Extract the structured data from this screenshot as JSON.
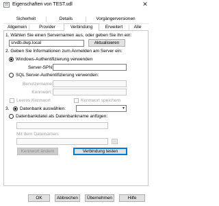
{
  "window": {
    "title": "Eigenschaften von TEST.udl",
    "close_glyph": "✕"
  },
  "tabs": {
    "row1": [
      {
        "label": "Sicherheit"
      },
      {
        "label": "Details"
      },
      {
        "label": "Vorgängerversionen"
      }
    ],
    "row2": [
      {
        "label": "Allgemein"
      },
      {
        "label": "Provider"
      },
      {
        "label": "Verbindung"
      },
      {
        "label": "Erweitert"
      },
      {
        "label": "Alle"
      }
    ],
    "selected": "Verbindung"
  },
  "step1": {
    "label": "1. Wählen Sie einen Servernamen aus, oder geben Sie ihn ein:",
    "server_value": "srvdb.dwp.local",
    "refresh_button": "Aktualisieren"
  },
  "step2": {
    "label": "2. Geben Sie Informationen zum Anmelden am Server ein:",
    "windows_auth": {
      "label": "Windows-Authentifizierung verwenden",
      "checked": true
    },
    "spn_label": "Server-SPN:",
    "spn_value": "",
    "sql_auth": {
      "label": "SQL Server-Authentifizierung verwenden:",
      "checked": false
    },
    "username_label": "Benutzername:",
    "password_label": "Kennwort:",
    "empty_password_label": "Leeres Kennwort",
    "save_password_label": "Kennwort speichern"
  },
  "step3": {
    "label": "3.",
    "select_db": {
      "label": "Datenbank auswählen:",
      "checked": true,
      "value": ""
    },
    "attach_file": {
      "label": "Datenbankdatei als Datenbankname anfügen:",
      "checked": false
    },
    "filename_label": "Mit dem Dateinamen:",
    "browse_label": "...",
    "dropdown_glyph": "▾"
  },
  "actions": {
    "change_password": "Kennwort ändern",
    "test_connection": "Verbindung testen"
  },
  "footer": {
    "ok": "OK",
    "cancel": "Abbrechen",
    "apply": "Übernehmen",
    "help": "Hilfe"
  },
  "colors": {
    "accent": "#0078d7",
    "disabled_text": "#a0a0a0"
  },
  "icons": {
    "app": "document-icon",
    "close": "close-icon"
  }
}
